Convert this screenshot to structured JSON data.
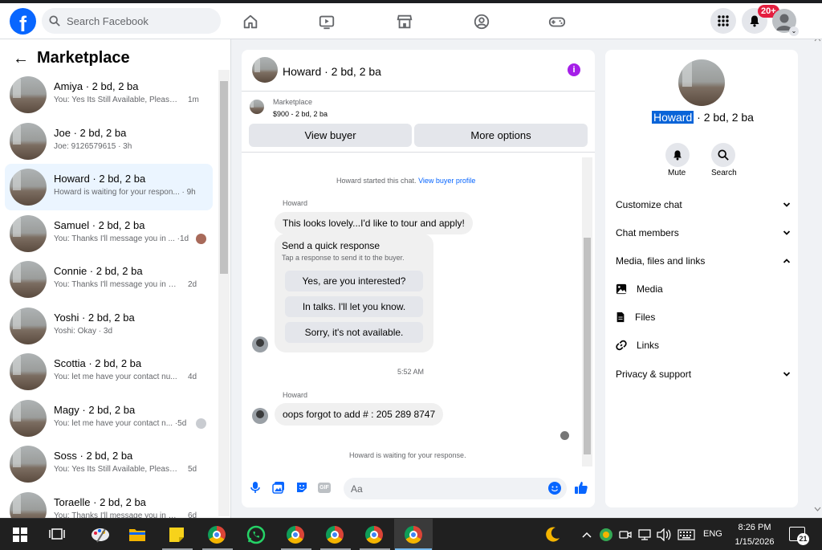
{
  "topbar": {
    "logo_icon": "facebook-f-icon",
    "search_placeholder": "Search Facebook",
    "nav_icons": [
      "home-icon",
      "watch-icon",
      "marketplace-icon",
      "groups-icon",
      "gaming-icon"
    ],
    "menu_icon": "grid-menu-icon",
    "notification_icon": "bell-icon",
    "notification_badge": "20+",
    "account_icon": "account-avatar-icon",
    "account_chevron": "⌄"
  },
  "sidebar": {
    "back_arrow": "←",
    "title": "Marketplace",
    "conversations": [
      {
        "name": "Amiya · 2 bd, 2 ba",
        "preview": "You: Yes Its Still Available, Please ...",
        "time": "1m"
      },
      {
        "name": "Joe · 2 bd, 2 ba",
        "preview": "Joe: 9126579615 · 3h",
        "time": ""
      },
      {
        "name": "Howard · 2 bd, 2 ba",
        "preview": "Howard is waiting for your respon... · 9h",
        "time": ""
      },
      {
        "name": "Samuel · 2 bd, 2 ba",
        "preview": "You: Thanks I'll message you in ... ·1d",
        "time": ""
      },
      {
        "name": "Connie · 2 bd, 2 ba",
        "preview": "You: Thanks I'll message you in a ...",
        "time": "2d"
      },
      {
        "name": "Yoshi · 2 bd, 2 ba",
        "preview": "Yoshi: Okay · 3d",
        "time": ""
      },
      {
        "name": "Scottia · 2 bd, 2 ba",
        "preview": "You: let me have your contact nu...",
        "time": "4d"
      },
      {
        "name": "Magy · 2 bd, 2 ba",
        "preview": "You: let me have your contact n... ·5d",
        "time": ""
      },
      {
        "name": "Soss · 2 bd, 2 ba",
        "preview": "You: Yes Its Still Available, Please S...",
        "time": "5d"
      },
      {
        "name": "Toraelle · 2 bd, 2 ba",
        "preview": "You: Thanks I'll message you in a ...",
        "time": "6d"
      }
    ]
  },
  "chat": {
    "title": "Howard · 2 bd, 2 ba",
    "info_icon": "i",
    "listing_source": "Marketplace",
    "listing_detail": "$900 - 2 bd, 2 ba",
    "view_buyer": "View buyer",
    "more_options": "More options",
    "started_text": "Howard started this chat.",
    "view_profile_link": "View buyer profile",
    "sender1": "Howard",
    "message1": "This looks lovely...I'd like to tour and apply!",
    "quick_title": "Send a quick response",
    "quick_subtitle": "Tap a response to send it to the buyer.",
    "quick_replies": [
      "Yes, are you interested?",
      "In talks. I'll let you know.",
      "Sorry, it's not available."
    ],
    "timestamp": "5:52 AM",
    "sender2": "Howard",
    "message2": "oops forgot to add # : 205 289 8747",
    "waiting_text": "Howard is waiting for your response.",
    "composer_placeholder": "Aa",
    "composer_icons": [
      "microphone-icon",
      "image-icon",
      "sticker-icon",
      "gif-icon",
      "emoji-icon",
      "thumbs-up-icon"
    ],
    "gif_label": "GIF"
  },
  "details": {
    "name_highlight": "Howard",
    "name_rest": " · 2 bd, 2 ba",
    "mute_label": "Mute",
    "search_label": "Search",
    "customize_chat": "Customize chat",
    "chat_members": "Chat members",
    "media_files_links": "Media, files and links",
    "media": "Media",
    "files": "Files",
    "links": "Links",
    "privacy_support": "Privacy & support",
    "chevron_down": "⌄",
    "chevron_up": "⌃"
  },
  "taskbar": {
    "apps": [
      "start-icon",
      "task-view-icon",
      "paint-icon",
      "file-explorer-icon",
      "sticky-notes-icon",
      "chrome-profile-m-icon",
      "whatsapp-icon",
      "chrome-icon",
      "chrome-profile-2-icon",
      "chrome-profile-3-icon",
      "chrome-profile-4-icon"
    ],
    "language": "ENG",
    "time": "8:26 PM",
    "date": "1/15/2026",
    "notification_count": "21"
  },
  "colors": {
    "accent": "#0866ff",
    "active_row": "#ebf5ff",
    "badge": "#e41e3f",
    "info": "#a51fe8",
    "taskbar": "#202020"
  }
}
